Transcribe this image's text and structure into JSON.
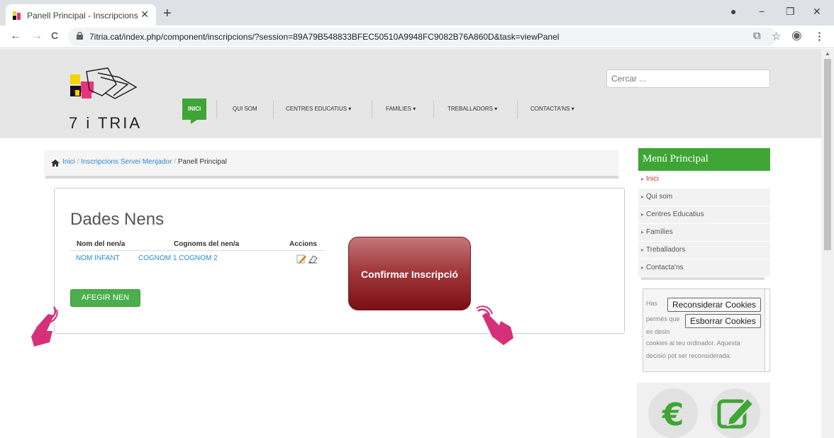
{
  "browser": {
    "tab_title": "Panell Principal - Inscripcions Menjador",
    "tab_close": "✕",
    "new_tab": "+",
    "url": "7itria.cat/index.php/component/inscripcions/?session=89A79B548833BFEC50510A9948FC9082B76A860D&task=viewPanel",
    "back": "←",
    "forward": "→",
    "reload": "C",
    "minimize": "−",
    "restore": "❐",
    "close": "✕",
    "profile": "●",
    "translate": "⧉",
    "star": "☆",
    "account": "◉",
    "menu": "⋮"
  },
  "header": {
    "logo_text": "7 i TRIA",
    "search_placeholder": "Cercar ...",
    "nav": [
      {
        "label": "INICI"
      },
      {
        "label": "QUI SOM"
      },
      {
        "label": "CENTRES EDUCATIUS ▾"
      },
      {
        "label": "FAMÍLIES ▾"
      },
      {
        "label": "TREBALLADORS ▾"
      },
      {
        "label": "CONTACTA'NS ▾"
      }
    ]
  },
  "breadcrumb": {
    "home": "Inici",
    "section": "Inscripcions Servei Menjador",
    "current": "Panell Principal",
    "sep": " / "
  },
  "main": {
    "title": "Dades Nens",
    "columns": [
      "Nom del nen/a",
      "Cognoms del nen/a",
      "Accions"
    ],
    "rows": [
      {
        "nom": "NOM INFANT",
        "cognoms": "COGNOM 1 COGNOM 2"
      }
    ],
    "add_button": "AFEGIR NEN",
    "confirm_button": "Confirmar Inscripció"
  },
  "sidebar": {
    "title": "Menú Principal",
    "items": [
      "Inici",
      "Qui som",
      "Centres Educatius",
      "Famílies",
      "Treballadors",
      "Contacta'ns"
    ]
  },
  "cookies": {
    "line1": "Has",
    "line2": "permès que",
    "line3": "es desin",
    "line4": "cookies al teu ordinador. Aquesta",
    "line5": "decisió pot ser reconsiderada.",
    "reconsider_button": "Reconsiderar Cookies",
    "delete_button": "Esborrar Cookies"
  },
  "colors": {
    "accent_green": "#3fa535",
    "link_blue": "#2a8ad3",
    "confirm_red": "#7a0f12",
    "hand_pink": "#d6307a"
  },
  "icons": [
    "home-icon",
    "edit-icon",
    "delete-icon",
    "euro-icon",
    "pencil-square-icon",
    "pointing-hand-icon"
  ]
}
